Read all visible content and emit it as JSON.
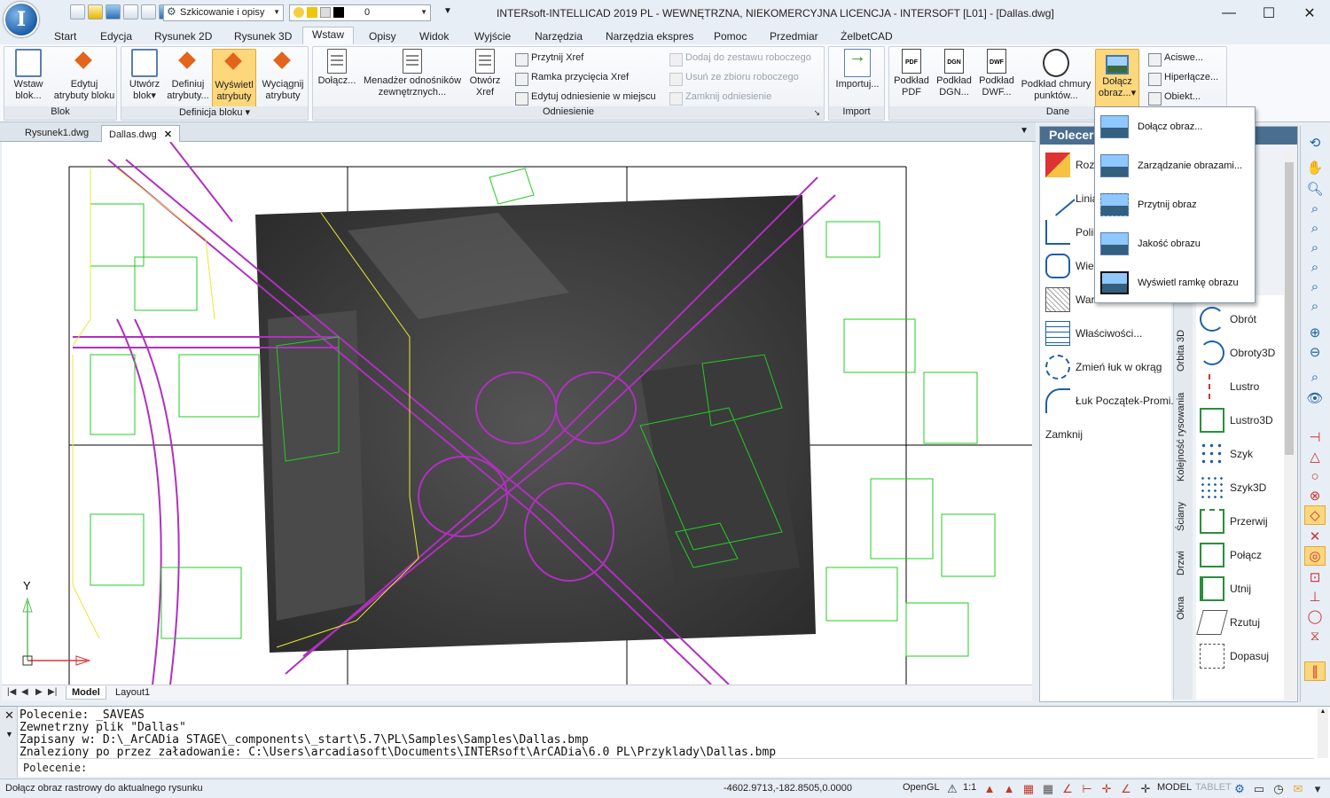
{
  "app": {
    "logo": "I",
    "title": "INTERsoft-INTELLICAD 2019 PL - WEWNĘTRZNA, NIEKOMERCYJNA LICENCJA - INTERSOFT [L01] - [Dallas.dwg]",
    "workspace": "Szkicowanie i opisy",
    "layer": "0",
    "window_controls": {
      "minimize": "—",
      "maximize": "☐",
      "close": "✕"
    }
  },
  "menu_tabs": [
    "Start",
    "Edycja",
    "Rysunek 2D",
    "Rysunek 3D",
    "Wstaw",
    "Opisy",
    "Widok",
    "Wyjście",
    "Narzędzia",
    "Narzędzia ekspres",
    "Pomoc",
    "Przedmiar",
    "ŻelbetCAD"
  ],
  "active_menu_tab": "Wstaw",
  "ribbon": {
    "blok": {
      "title": "Blok",
      "buttons": [
        "Wstaw blok...",
        "Edytuj atrybuty bloku"
      ]
    },
    "definicja": {
      "title": "Definicja bloku ▾",
      "buttons": [
        "Utwórz blok▾",
        "Definiuj atrybuty...",
        "Wyświetl atrybuty",
        "Wyciągnij atrybuty"
      ]
    },
    "odniesienie": {
      "title": "Odniesienie",
      "buttons": [
        "Dołącz...",
        "Menadżer odnośników zewnętrznych...",
        "Otwórz Xref"
      ],
      "small": [
        "Przytnij Xref",
        "Ramka przycięcia Xref",
        "Edytuj odniesienie w miejscu"
      ],
      "small_disabled": [
        "Dodaj do zestawu roboczego",
        "Usuń ze zbioru roboczego",
        "Zamknij odniesienie"
      ]
    },
    "import": {
      "title": "Import",
      "buttons": [
        "Importuj..."
      ]
    },
    "dane": {
      "title": "Dane",
      "buttons": [
        "Podkład PDF",
        "Podkład DGN...",
        "Podkład DWF...",
        "Podkład chmury punktów...",
        "Dołącz obraz...▾"
      ],
      "small": [
        "Aciswe...",
        "Hiperłącze...",
        "Obiekt..."
      ]
    }
  },
  "doc_tabs": [
    "Rysunek1.dwg",
    "Dallas.dwg"
  ],
  "active_doc": "Dallas.dwg",
  "layout_tabs": [
    "Model",
    "Layout1"
  ],
  "axis": {
    "y": "Y"
  },
  "image_menu": [
    "Dołącz obraz...",
    "Zarządzanie obrazami...",
    "Przytnij obraz",
    "Jakość obrazu",
    "Wyświetl ramkę obrazu"
  ],
  "palette": {
    "title": "Polecer",
    "left_items": [
      "Rozb",
      "Linia",
      "Polilin",
      "Wielo",
      "Wars",
      "Właściwości...",
      "Zmień łuk w okrąg",
      "Łuk Początek-Promi...",
      "Zamknij"
    ],
    "vertical_tabs": [
      "Orbita 3D",
      "Kolejność rysowania",
      "Ściany",
      "Drzwi",
      "Okna"
    ],
    "right_items": [
      "Obrót",
      "Obroty3D",
      "Lustro",
      "Lustro3D",
      "Szyk",
      "Szyk3D",
      "Przerwij",
      "Połącz",
      "Utnij",
      "Rzutuj",
      "Dopasuj"
    ]
  },
  "command_history": [
    "Polecenie: _SAVEAS",
    "Zewnetrzny plik \"Dallas\"",
    "Zapisany w: D:\\_ArCADia STAGE\\_components\\_start\\5.7\\PL\\Samples\\Samples\\Dallas.bmp",
    "Znaleziony po przez załadowanie: C:\\Users\\arcadiasoft\\Documents\\INTERsoft\\ArCADia\\6.0 PL\\Przyklady\\Dallas.bmp"
  ],
  "command_prompt": "Polecenie:",
  "status": {
    "message": "Dołącz obraz rastrowy do aktualnego rysunku",
    "coords": "-4602.9713,-182.8505,0.0000",
    "renderer": "OpenGL",
    "scale": "1:1",
    "space": "MODEL",
    "tablet": "TABLET"
  },
  "colors": {
    "accent": "#1d5fa8",
    "active_button": "#fcd77b",
    "cad_green": "#22cc22",
    "cad_magenta": "#b030c0",
    "cad_yellow": "#e8e830",
    "palette_header": "#4a6e90"
  }
}
